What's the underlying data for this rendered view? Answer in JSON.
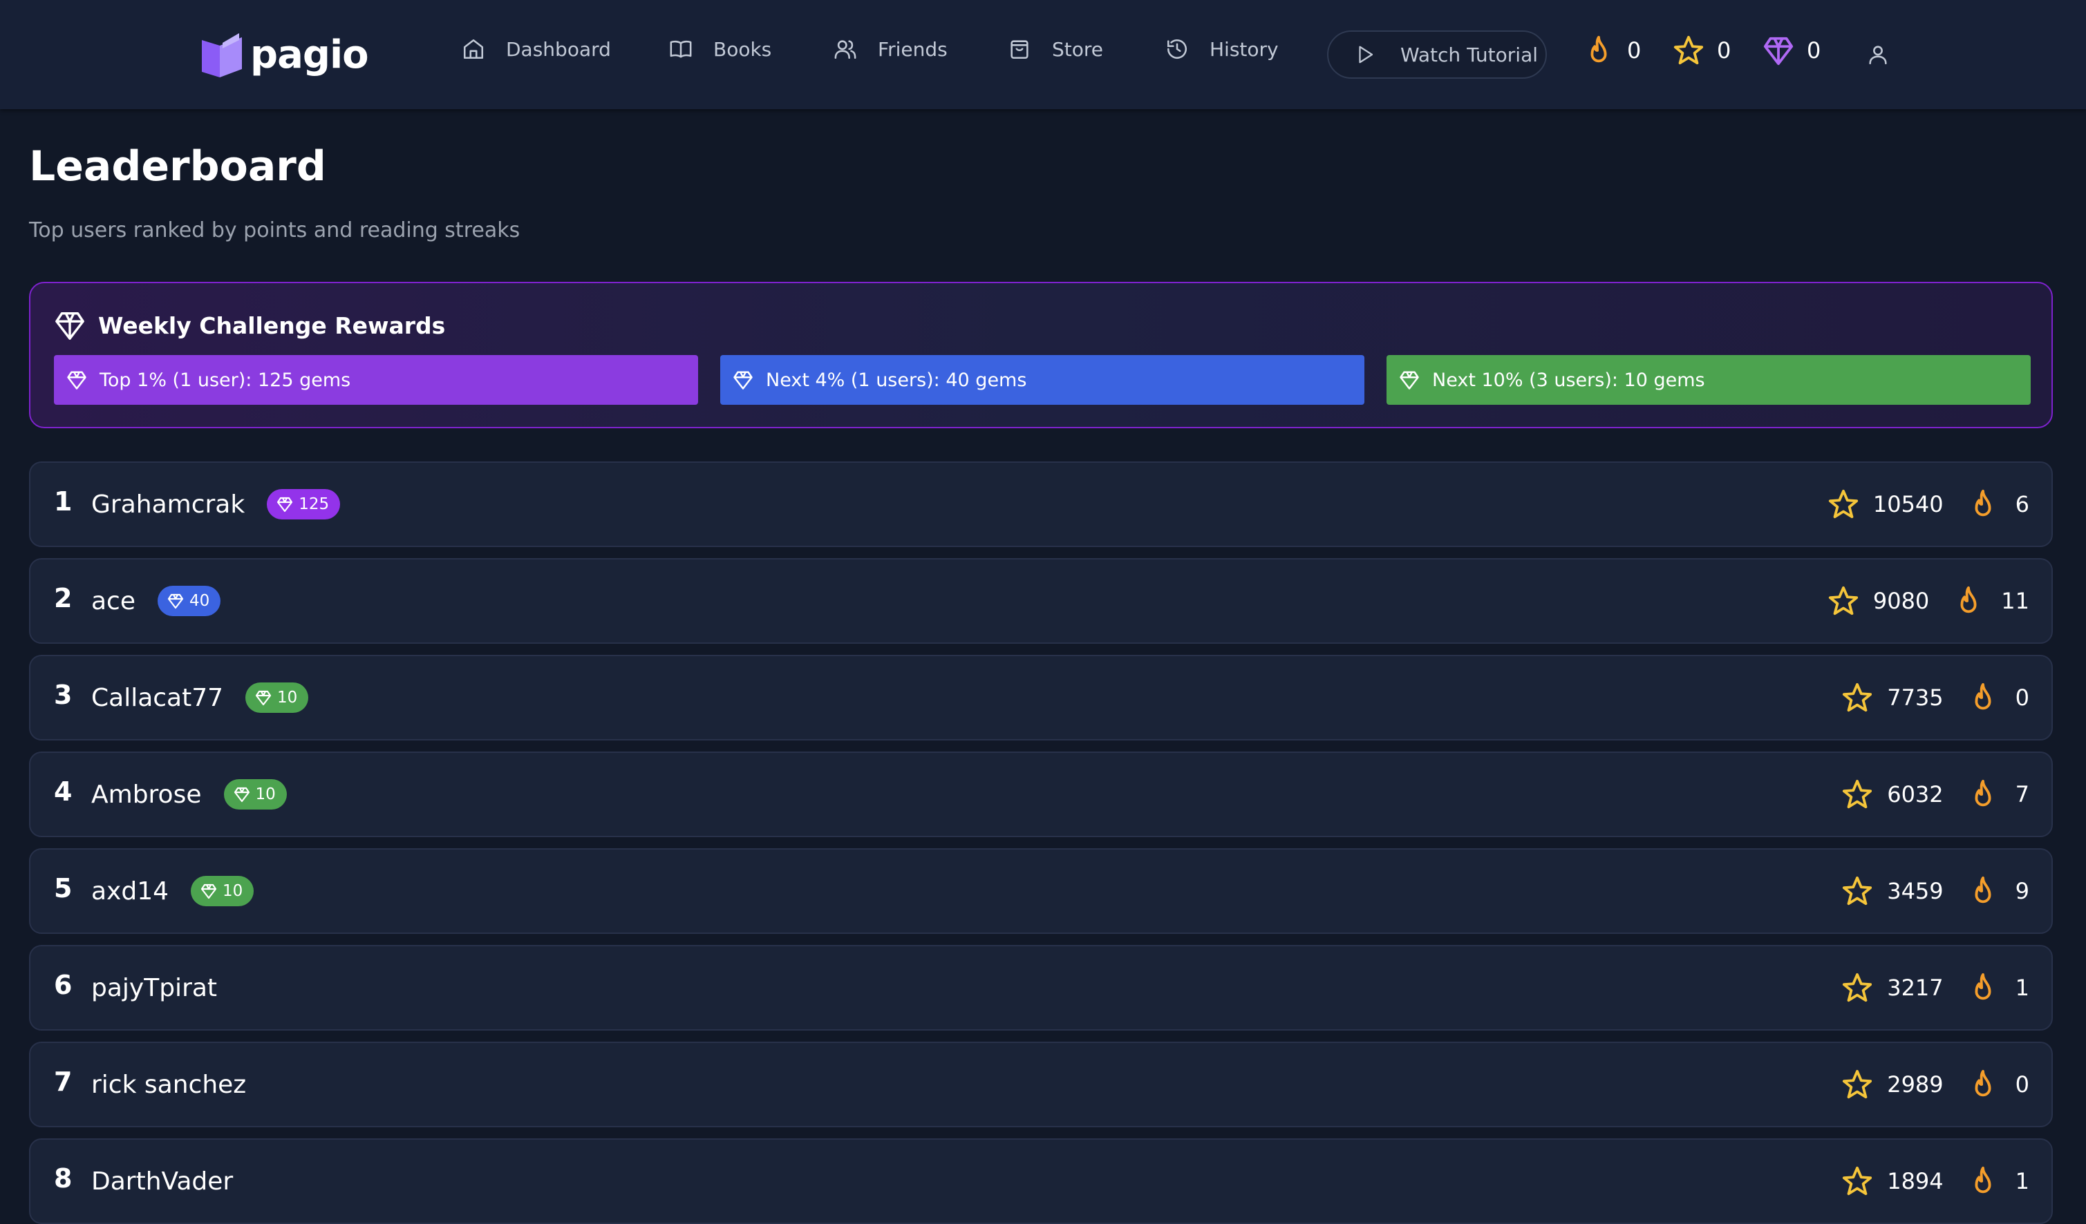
{
  "app": {
    "brand": "pagio",
    "nav": [
      {
        "label": "Dashboard",
        "icon": "home-icon"
      },
      {
        "label": "Books",
        "icon": "book-icon"
      },
      {
        "label": "Friends",
        "icon": "users-icon"
      },
      {
        "label": "Store",
        "icon": "shopping-bag-icon"
      },
      {
        "label": "History",
        "icon": "history-icon"
      }
    ],
    "tutorial_label": "Watch Tutorial",
    "stats": {
      "streak": "0",
      "points": "0",
      "gems": "0"
    }
  },
  "page": {
    "title": "Leaderboard",
    "subtitle": "Top users ranked by points and reading streaks"
  },
  "rewards": {
    "title": "Weekly Challenge Rewards",
    "tiers": [
      {
        "label": "Top 1% (1 user): 125 gems",
        "color": "#8b3ce0"
      },
      {
        "label": "Next 4% (1 users): 40 gems",
        "color": "#3b63e0"
      },
      {
        "label": "Next 10% (3 users): 10 gems",
        "color": "#4ca34f"
      }
    ]
  },
  "leaderboard": [
    {
      "rank": "1",
      "name": "Grahamcrak",
      "gems": "125",
      "points": "10540",
      "streak": "6"
    },
    {
      "rank": "2",
      "name": "ace",
      "gems": "40",
      "points": "9080",
      "streak": "11"
    },
    {
      "rank": "3",
      "name": "Callacat77",
      "gems": "10",
      "points": "7735",
      "streak": "0"
    },
    {
      "rank": "4",
      "name": "Ambrose",
      "gems": "10",
      "points": "6032",
      "streak": "7"
    },
    {
      "rank": "5",
      "name": "axd14",
      "gems": "10",
      "points": "3459",
      "streak": "9"
    },
    {
      "rank": "6",
      "name": "pajyTpirat",
      "points": "3217",
      "streak": "1"
    },
    {
      "rank": "7",
      "name": "rick sanchez",
      "points": "2989",
      "streak": "0"
    },
    {
      "rank": "8",
      "name": "DarthVader",
      "points": "1894",
      "streak": "1"
    }
  ],
  "colors": {
    "background": "#111827",
    "topbar": "#172036",
    "accent_purple": "#9333ea",
    "star": "#f5c53a",
    "flame": "#f59e2b",
    "gem": "#b069f5"
  }
}
